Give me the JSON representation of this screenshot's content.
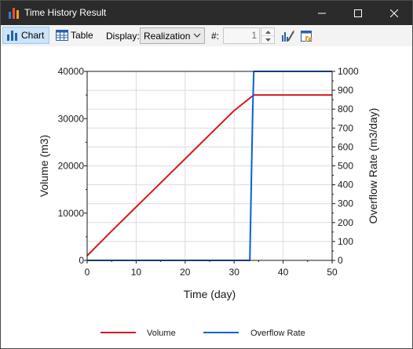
{
  "window": {
    "title": "Time History Result",
    "minimize_glyph": "—",
    "maximize_glyph": "☐",
    "close_glyph": "✕",
    "icon": "bar-chart-icon"
  },
  "toolbar": {
    "chart_label": "Chart",
    "table_label": "Table",
    "display_label": "Display:",
    "display_value": "Realization",
    "count_label": "#:",
    "count_value": "1"
  },
  "colors": {
    "volume": "#d7191c",
    "overflow": "#0a5ed7",
    "grid": "#dcdcdc",
    "axis": "#1a1a1a"
  },
  "chart_data": {
    "type": "line",
    "xlabel": "Time (day)",
    "ylabel_left": "Volume (m3)",
    "ylabel_right": "Overflow Rate (m3/day)",
    "xlim": [
      0,
      50
    ],
    "ylim_left": [
      0,
      40000
    ],
    "ylim_right": [
      0,
      1000
    ],
    "x_ticks": [
      0,
      10,
      20,
      30,
      40,
      50
    ],
    "y_left_ticks": [
      0,
      10000,
      20000,
      30000,
      40000
    ],
    "y_right_ticks": [
      0,
      100,
      200,
      300,
      400,
      500,
      600,
      700,
      800,
      900,
      1000
    ],
    "grid": true,
    "legend_position": "bottom",
    "series": [
      {
        "name": "Volume",
        "axis": "left",
        "x": [
          0,
          5,
          10,
          15,
          20,
          25,
          30,
          34,
          35,
          40,
          45,
          50
        ],
        "y": [
          1000,
          6200,
          11300,
          16400,
          21500,
          26600,
          31700,
          35000,
          35000,
          35000,
          35000,
          35000
        ]
      },
      {
        "name": "Overflow Rate",
        "axis": "right",
        "x": [
          0,
          33.2,
          33.5,
          33.8,
          34,
          40,
          50
        ],
        "y": [
          0,
          0,
          400,
          800,
          1000,
          1000,
          1000
        ]
      }
    ]
  }
}
